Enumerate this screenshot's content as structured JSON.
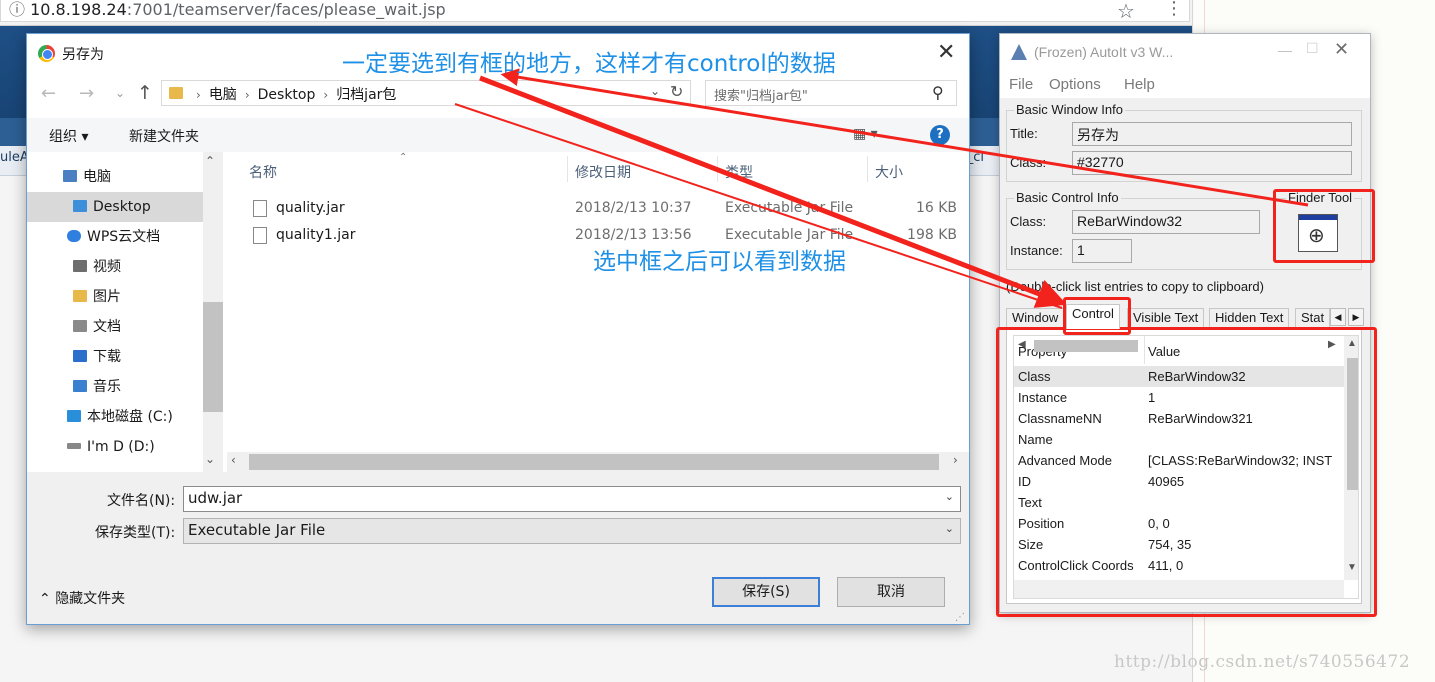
{
  "browser": {
    "url_host": "10.8.198.24",
    "url_rest": ":7001/teamserver/faces/please_wait.jsp",
    "page_tab_left": "uleA",
    "page_tab_right": "it_cl"
  },
  "save_dialog": {
    "title": "另存为",
    "breadcrumb": [
      "电脑",
      "Desktop",
      "归档jar包"
    ],
    "search_placeholder": "搜索\"归档jar包\"",
    "toolbar": {
      "organize": "组织 ▾",
      "new_folder": "新建文件夹",
      "help": "?"
    },
    "nav_items": [
      {
        "label": "电脑",
        "color": "#4a7fc1"
      },
      {
        "label": "Desktop",
        "color": "#3d8fd9"
      },
      {
        "label": "WPS云文档",
        "color": "#2f7fe0"
      },
      {
        "label": "视频",
        "color": "#6d6d6d"
      },
      {
        "label": "图片",
        "color": "#e8b94a"
      },
      {
        "label": "文档",
        "color": "#8a8a8a"
      },
      {
        "label": "下载",
        "color": "#2a6fc9"
      },
      {
        "label": "音乐",
        "color": "#3b7fd0"
      },
      {
        "label": "本地磁盘 (C:)",
        "color": "#2a8fd9"
      },
      {
        "label": "I'm D (D:)",
        "color": "#888888"
      }
    ],
    "columns": {
      "name": "名称",
      "modified": "修改日期",
      "type": "类型",
      "size": "大小"
    },
    "files": [
      {
        "name": "quality.jar",
        "modified": "2018/2/13 10:37",
        "type": "Executable Jar File",
        "size": "16 KB"
      },
      {
        "name": "quality1.jar",
        "modified": "2018/2/13 13:56",
        "type": "Executable Jar File",
        "size": "198 KB"
      }
    ],
    "filename_label": "文件名(N):",
    "filename_value": "udw.jar",
    "filetype_label": "保存类型(T):",
    "filetype_value": "Executable Jar File",
    "hide_folders": "隐藏文件夹",
    "save_button": "保存(S)",
    "cancel_button": "取消"
  },
  "autoit": {
    "title": "(Frozen) AutoIt v3 W...",
    "menus": [
      "File",
      "Options",
      "Help"
    ],
    "basic_window_info": "Basic Window Info",
    "title_label": "Title:",
    "title_value": "另存为",
    "class_label": "Class:",
    "class_value": "#32770",
    "basic_control_info": "Basic Control Info",
    "ctrl_class_label": "Class:",
    "ctrl_class_value": "ReBarWindow32",
    "instance_label": "Instance:",
    "instance_value": "1",
    "finder_tool": "Finder Tool",
    "dblclick_hint": "(Double-click list entries to copy to clipboard)",
    "tabs": [
      "Window",
      "Control",
      "Visible Text",
      "Hidden Text",
      "Stat"
    ],
    "active_tab": 1,
    "list_headers": {
      "property": "Property",
      "value": "Value"
    },
    "properties": [
      {
        "property": "Class",
        "value": "ReBarWindow32"
      },
      {
        "property": "Instance",
        "value": "1"
      },
      {
        "property": "ClassnameNN",
        "value": "ReBarWindow321"
      },
      {
        "property": "Name",
        "value": ""
      },
      {
        "property": "Advanced Mode",
        "value": "[CLASS:ReBarWindow32; INST"
      },
      {
        "property": "ID",
        "value": "40965"
      },
      {
        "property": "Text",
        "value": ""
      },
      {
        "property": "Position",
        "value": "0, 0"
      },
      {
        "property": "Size",
        "value": "754, 35"
      },
      {
        "property": "ControlClick Coords",
        "value": "411, 0"
      }
    ]
  },
  "annotations": {
    "note_top": "一定要选到有框的地方，这样才有control的数据",
    "note_middle": "选中框之后可以看到数据",
    "color": "#f2231c",
    "text_color": "#1e90e6"
  },
  "watermark": "http://blog.csdn.net/s740556472"
}
